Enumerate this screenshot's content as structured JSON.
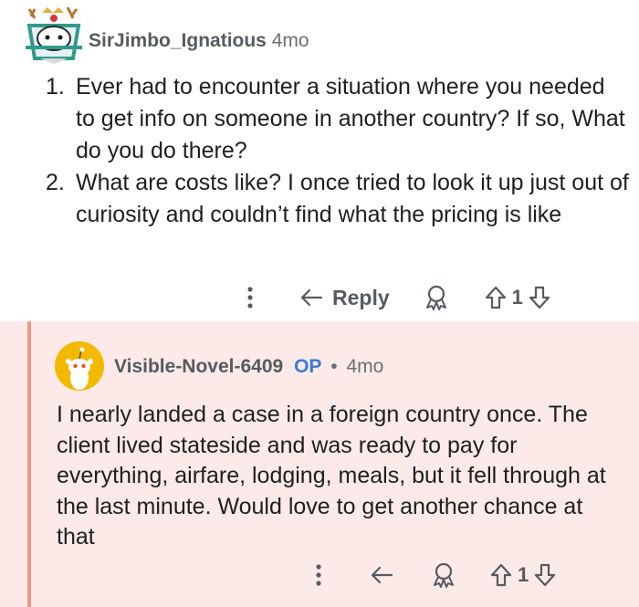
{
  "comment1": {
    "username": "SirJimbo_Ignatious",
    "time": "4mo",
    "items": [
      {
        "num": "1.",
        "text": "Ever had to encounter a situation where you needed to get info on someone in another country? If so, What do you do there?"
      },
      {
        "num": "2.",
        "text": "What are costs like? I once tried to look it up just out of curiosity and couldn’t find what the pricing is like"
      }
    ],
    "reply_label": "Reply",
    "vote_count": "1"
  },
  "comment2": {
    "username": "Visible-Novel-6409",
    "op_badge": "OP",
    "separator": "•",
    "time": "4mo",
    "body": "I nearly landed a case in a foreign country once. The client lived stateside and was ready to pay for everything, airfare, lodging, meals, but it fell through at the last minute. Would love to get another chance at that",
    "vote_count": "1"
  },
  "colors": {
    "reply_background": "#fbeae7",
    "thread_line": "#ed9a85",
    "op_badge": "#3a7bd5",
    "icon_gray": "#555b61"
  },
  "icons": [
    "more-vertical-icon",
    "reply-arrow-icon",
    "award-icon",
    "upvote-icon",
    "downvote-icon"
  ]
}
